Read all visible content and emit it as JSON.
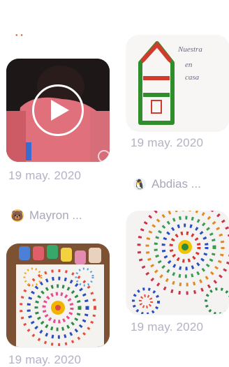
{
  "feed": {
    "left": [
      {
        "type": "video",
        "date": "19 may. 2020"
      },
      {
        "author": "Mayron ...",
        "avatar_icon": "bear-avatar"
      },
      {
        "type": "image",
        "date": "19 may. 2020"
      }
    ],
    "right": [
      {
        "type": "image",
        "handwritten": [
          "Nuestra",
          "en",
          "casa"
        ],
        "date": "19 may. 2020"
      },
      {
        "author": "Abdias ...",
        "avatar_icon": "penguin-avatar"
      },
      {
        "type": "image",
        "date": "19 may. 2020"
      }
    ]
  },
  "colors": {
    "date_text": "#b4b1c6",
    "author_text": "#a9a7b8"
  }
}
